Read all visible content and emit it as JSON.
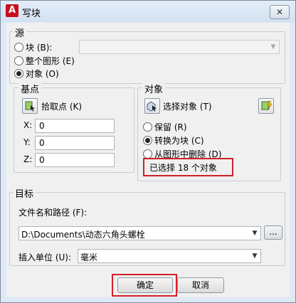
{
  "window": {
    "title": "写块",
    "close_glyph": "✕",
    "logo_glyph": "A"
  },
  "source": {
    "legend": "源",
    "block_label": "块 (B):",
    "block_value": "",
    "whole_drawing_label": "整个图形 (E)",
    "objects_label": "对象 (O)",
    "selected": "objects"
  },
  "base_point": {
    "legend": "基点",
    "pick_label": "拾取点 (K)",
    "x_label": "X:",
    "x_value": "0",
    "y_label": "Y:",
    "y_value": "0",
    "z_label": "Z:",
    "z_value": "0"
  },
  "objects": {
    "legend": "对象",
    "select_label": "选择对象 (T)",
    "retain_label": "保留 (R)",
    "convert_label": "转换为块 (C)",
    "delete_label": "从图形中删除 (D)",
    "selected_mode": "convert",
    "status": "已选择 18 个对象"
  },
  "target": {
    "legend": "目标",
    "path_label": "文件名和路径 (F):",
    "path_value": "D:\\Documents\\动态六角头螺栓",
    "browse_label": "...",
    "units_label": "插入单位 (U):",
    "units_value": "毫米"
  },
  "buttons": {
    "ok": "确定",
    "cancel": "取消"
  },
  "colors": {
    "highlight": "#d1202a",
    "app_red": "#c8101b"
  }
}
